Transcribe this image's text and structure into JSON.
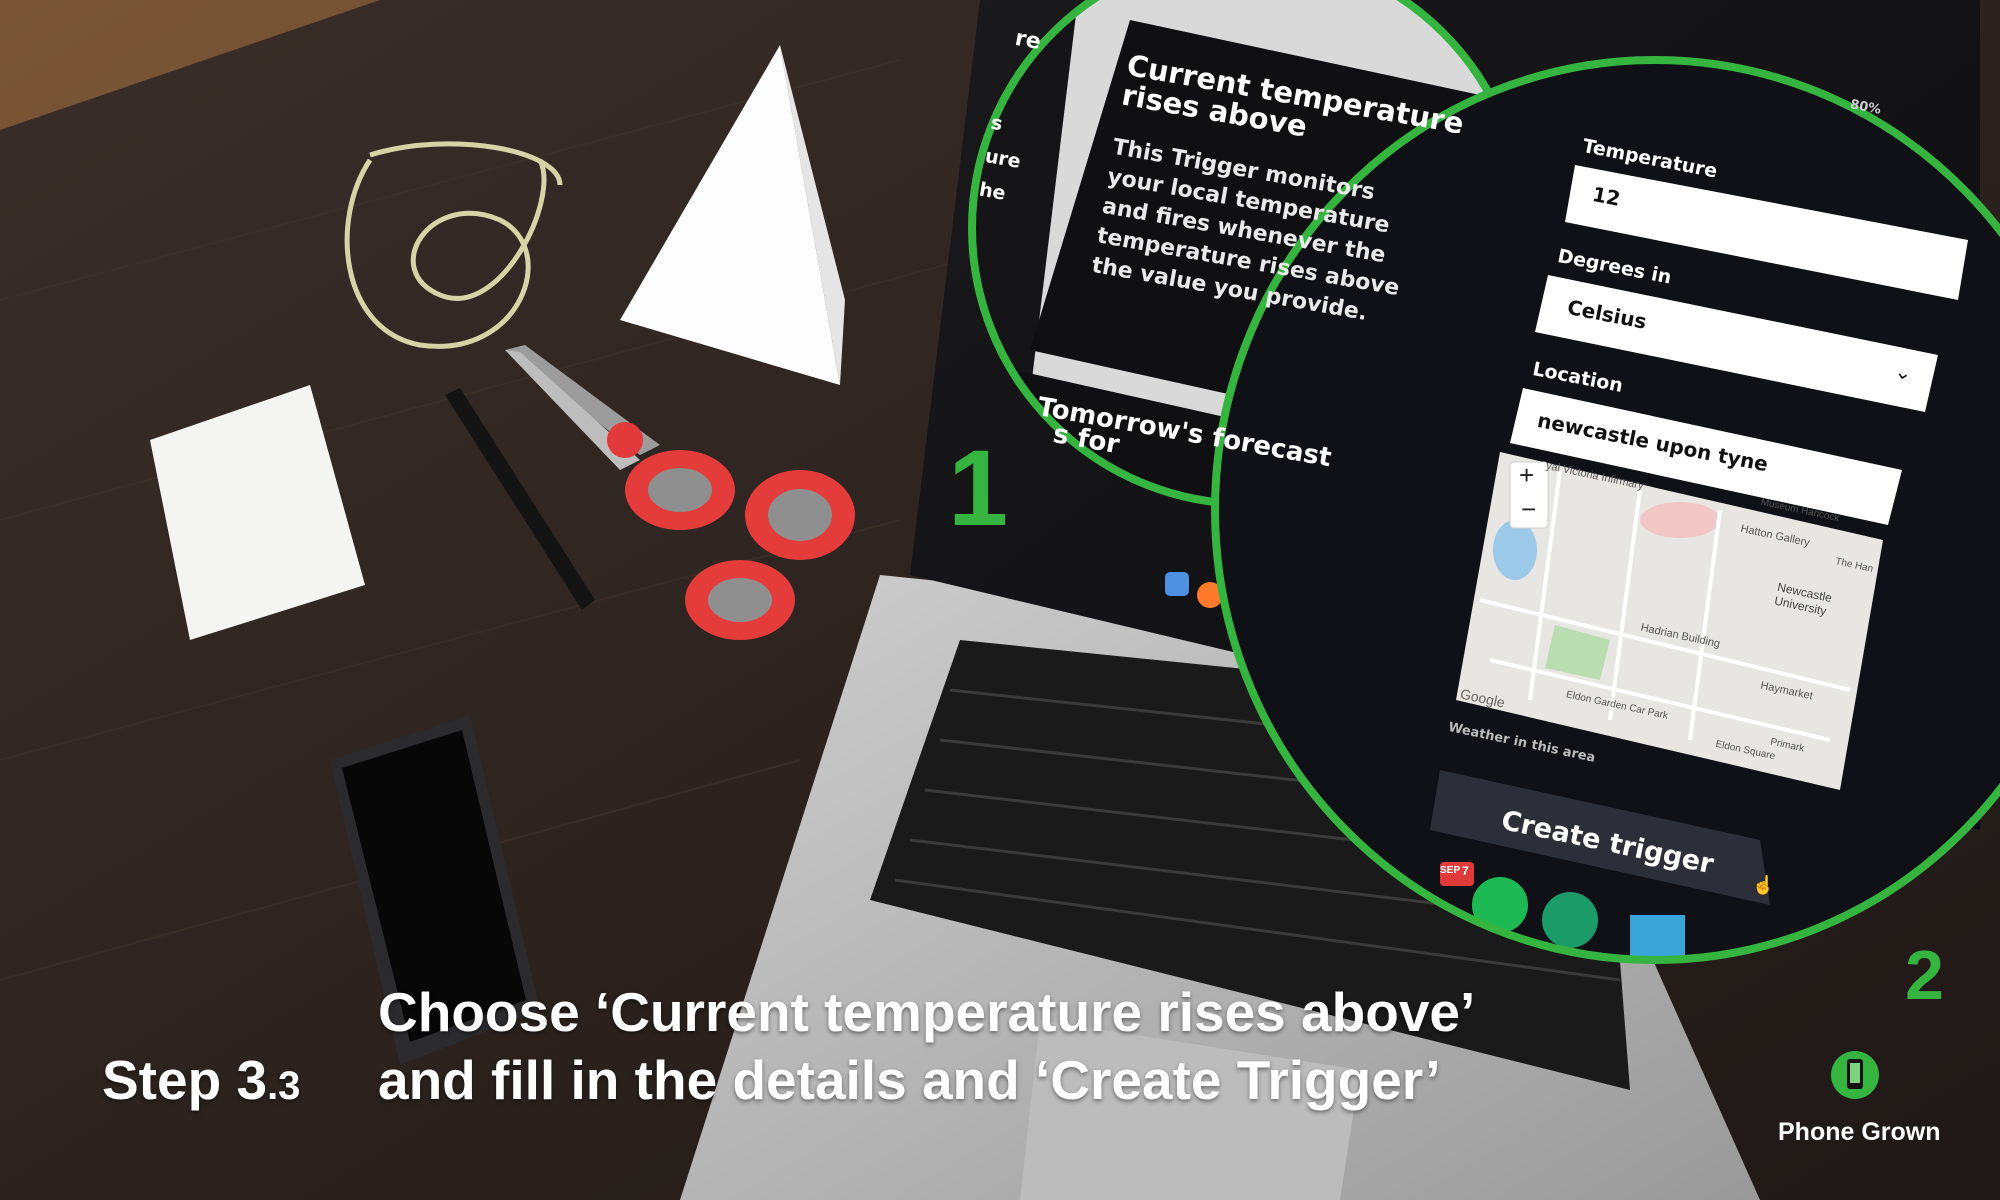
{
  "step": {
    "label": "Step 3",
    "sub": ".3"
  },
  "instruction": {
    "line1": "Choose ‘Current temperature rises above’",
    "line2": "and fill in the details and ‘Create Trigger’"
  },
  "markers": {
    "one": "1",
    "two": "2"
  },
  "brand": {
    "name": "Phone Grown"
  },
  "zoom1": {
    "edge_top": "re",
    "edge_mid": [
      "s",
      "ure",
      "he"
    ],
    "card_title_1": "Current temperature",
    "card_title_2": "rises above",
    "desc": [
      "This Trigger monitors",
      "your local temperature",
      "and fires whenever the",
      "temperature rises above",
      "the value you provide."
    ],
    "next_card_1": "Tomorrow's forecast",
    "next_card_2": "s for"
  },
  "zoom2": {
    "battery": "80%",
    "temperature_label": "Temperature",
    "temperature_value": "12",
    "degrees_label": "Degrees in",
    "degrees_value": "Celsius",
    "location_label": "Location",
    "location_value": "newcastle upon tyne",
    "map_labels": [
      "yal Victoria Infirmary",
      "Hatton Gallery",
      "Newcastle University",
      "Hadrian Building",
      "Haymarket",
      "Eldon Garden Car Park",
      "Eldon Square",
      "Primark",
      "Museum Hancock",
      "The Han"
    ],
    "map_zoom_in": "+",
    "map_zoom_out": "−",
    "google": "Google",
    "map_caption": "Weather in this area",
    "create_button": "Create trigger",
    "dock_badge": "7",
    "dock_badge_month": "SEP"
  },
  "colors": {
    "accent": "#35b440",
    "table": "#2a211e",
    "floor": "#6b4a32"
  }
}
